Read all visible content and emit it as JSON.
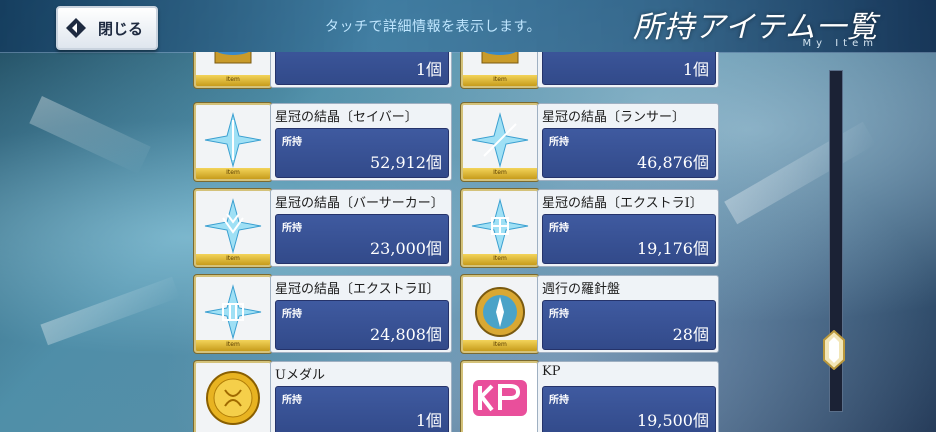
{
  "header": {
    "close_label": "閉じる",
    "hint": "タッチで詳細情報を表示します。",
    "title": "所持アイテム一覧",
    "subtitle": "My Item"
  },
  "items": [
    {
      "name": "",
      "owned_label": "",
      "quantity": "1個",
      "icon": "gold-pedestal-icon"
    },
    {
      "name": "",
      "owned_label": "",
      "quantity": "1個",
      "icon": "gold-pedestal-icon"
    },
    {
      "name": "星冠の結晶〔セイバー〕",
      "owned_label": "所持",
      "quantity": "52,912個",
      "icon": "saber-crystal-icon"
    },
    {
      "name": "星冠の結晶〔ランサー〕",
      "owned_label": "所持",
      "quantity": "46,876個",
      "icon": "lancer-crystal-icon"
    },
    {
      "name": "星冠の結晶〔バーサーカー〕",
      "owned_label": "所持",
      "quantity": "23,000個",
      "icon": "berserker-crystal-icon"
    },
    {
      "name": "星冠の結晶〔エクストラⅠ〕",
      "owned_label": "所持",
      "quantity": "19,176個",
      "icon": "extra1-crystal-icon"
    },
    {
      "name": "星冠の結晶〔エクストラⅡ〕",
      "owned_label": "所持",
      "quantity": "24,808個",
      "icon": "extra2-crystal-icon"
    },
    {
      "name": "週行の羅針盤",
      "owned_label": "所持",
      "quantity": "28個",
      "icon": "compass-icon"
    },
    {
      "name": "Uメダル",
      "owned_label": "所持",
      "quantity": "1個",
      "icon": "gold-medal-icon"
    },
    {
      "name": "KP",
      "owned_label": "所持",
      "quantity": "19,500個",
      "icon": "kp-icon"
    }
  ],
  "rarity_label": "Item",
  "colors": {
    "quantity_panel": "#3f5aa0",
    "rarity_band": "#e0b83a",
    "header_bg": "#2a5e86"
  }
}
